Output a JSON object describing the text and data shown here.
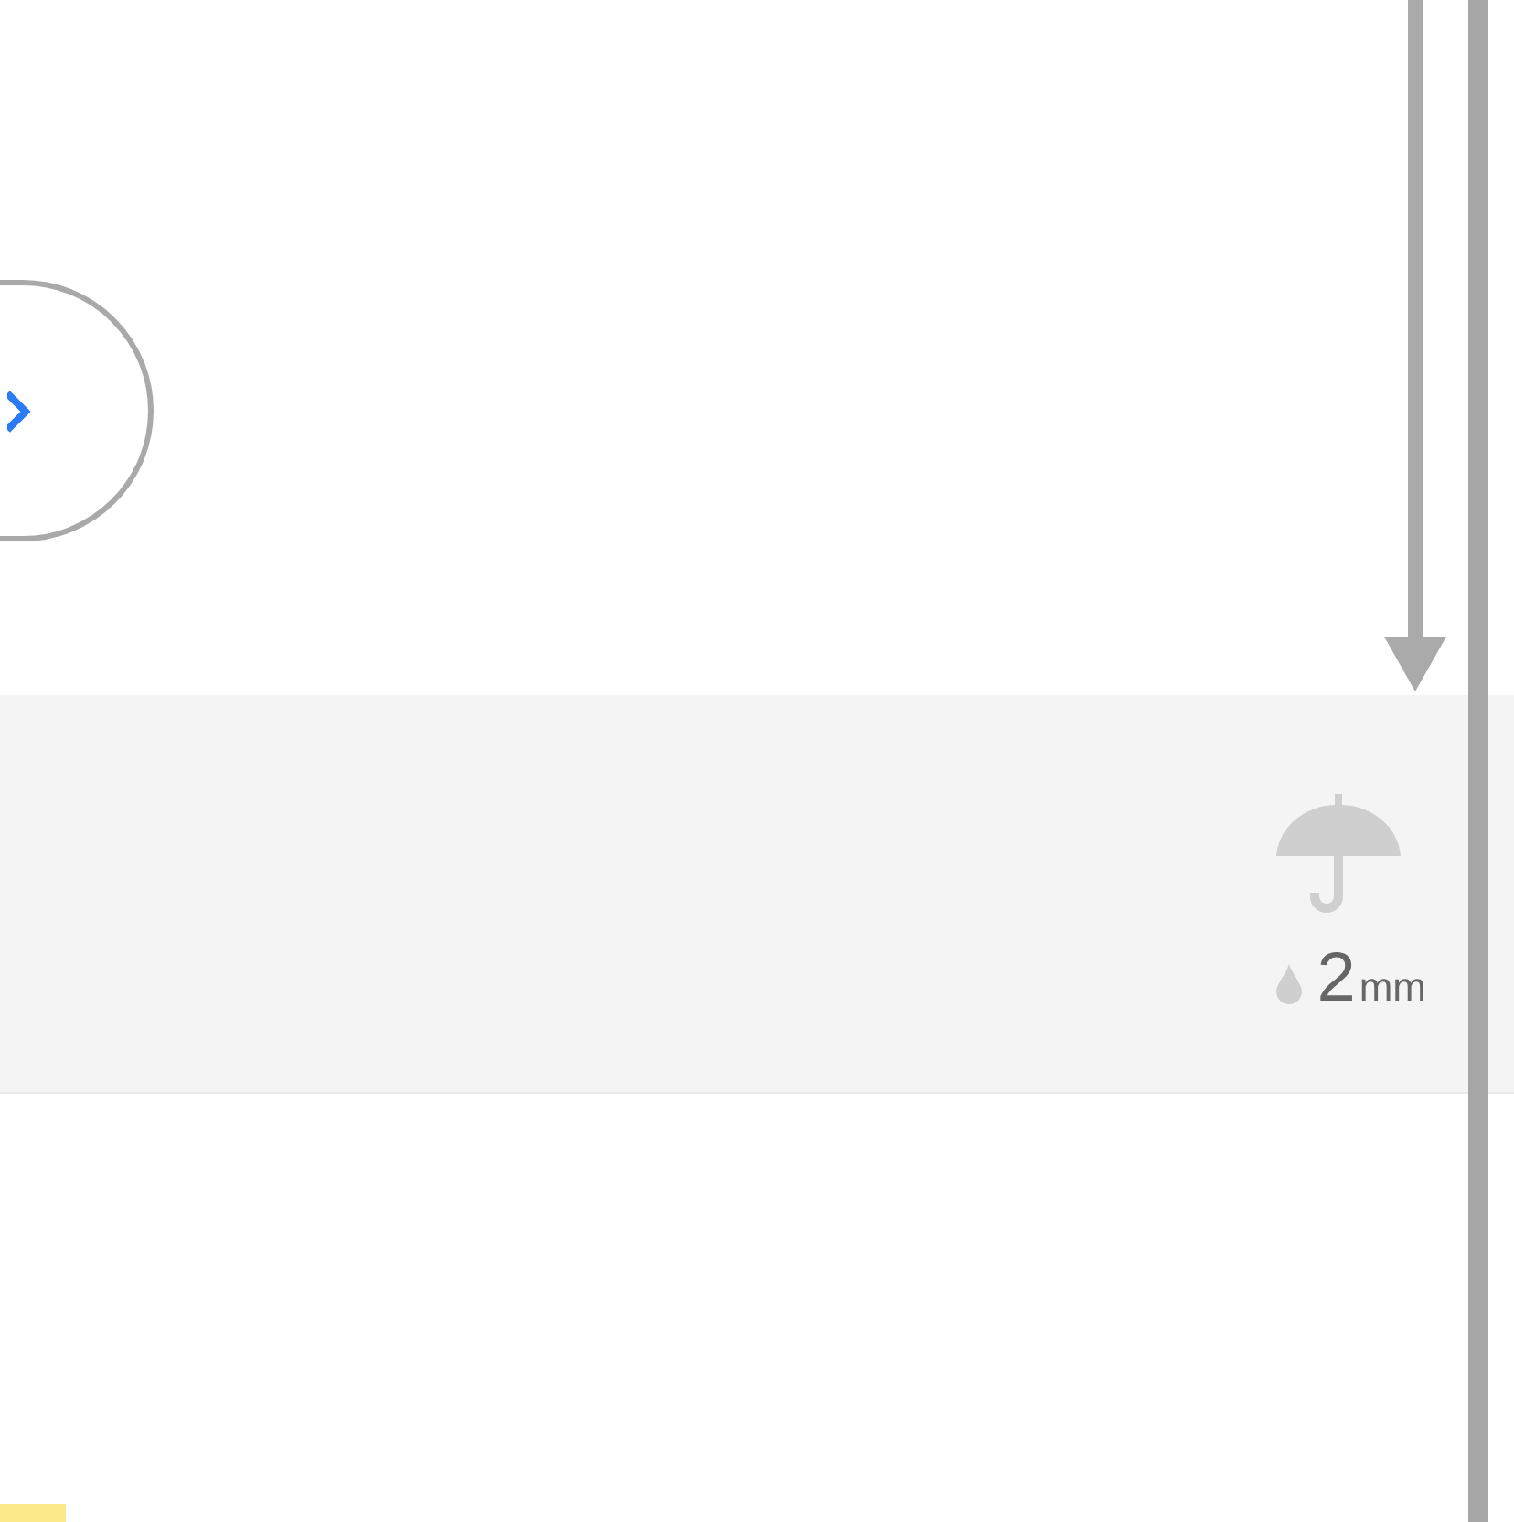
{
  "rain": {
    "amount": "2",
    "unit": "mm"
  }
}
